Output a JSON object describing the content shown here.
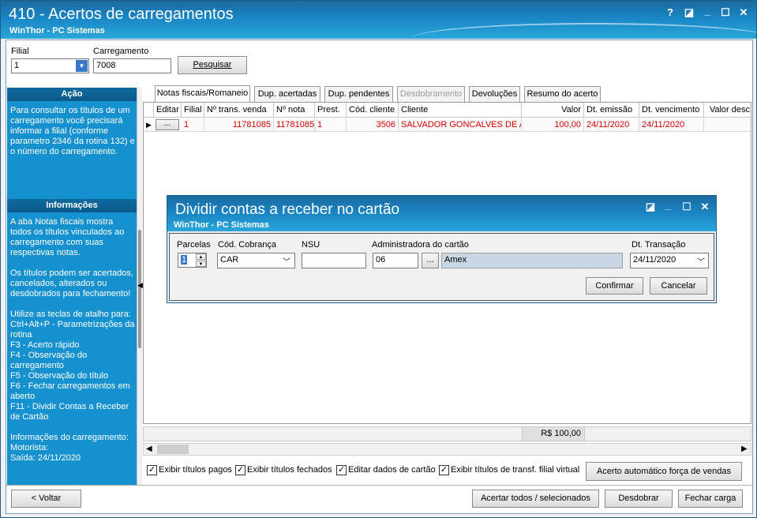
{
  "window": {
    "title": "410 - Acertos de carregamentos",
    "subtitle": "WinThor - PC Sistemas",
    "controls": {
      "help": "?",
      "restore": "◪",
      "minimize": "_",
      "maximize": "☐",
      "close": "✕"
    }
  },
  "filters": {
    "filial_label": "Filial",
    "filial_value": "1",
    "carregamento_label": "Carregamento",
    "carregamento_value": "7008",
    "search_button": "Pesquisar"
  },
  "left_panel": {
    "acao_header": "Ação",
    "acao_text": "Para consultar os títulos de um carregamento você precisará informar a filial (conforme parametro 2346 da rotina 132) e o número do carregamento.",
    "info_header": "Informações",
    "info_text": "A aba Notas fiscais mostra todos os títulos vinculados ao carregamento com suas respectivas notas.\n\nOs títulos podem ser acertados, cancelados, alterados ou desdobrados para fechamento!\n\nUtilize as teclas de atalho para:\nCtrl+Alt+P - Parametrizações da rotina\nF3 - Acerto rápido\nF4 - Observação do carregamento\nF5 - Observação do título\nF6 - Fechar carregamentos em aberto\nF11 - Dividir Contas a Receber de Cartão\n\nInformações do carregamento:\nMotorista:\nSaída: 24/11/2020"
  },
  "tabs": [
    {
      "label": "Notas fiscais/Romaneio",
      "state": "active"
    },
    {
      "label": "Dup. acertadas",
      "state": "normal"
    },
    {
      "label": "Dup. pendentes",
      "state": "normal"
    },
    {
      "label": "Desdobramento",
      "state": "disabled"
    },
    {
      "label": "Devoluções",
      "state": "normal"
    },
    {
      "label": "Resumo do acerto",
      "state": "normal"
    }
  ],
  "grid": {
    "columns": [
      "Editar",
      "Filial",
      "Nº trans. venda",
      "Nº nota",
      "Prest.",
      "Cód. cliente",
      "Cliente",
      "Valor",
      "Dt. emissão",
      "Dt. vencimento",
      "Valor desc"
    ],
    "rows": [
      {
        "edit": "...",
        "filial": "1",
        "trans": "11781085",
        "nota": "11781085",
        "prest": "1",
        "cod_cliente": "3506",
        "cliente": "SALVADOR GONCALVES DE ATAIDE",
        "valor": "100,00",
        "emissao": "24/11/2020",
        "vencimento": "24/11/2020",
        "desc": ""
      }
    ],
    "total": "R$ 100,00"
  },
  "dialog": {
    "title": "Dividir contas a receber no cartão",
    "subtitle": "WinThor - PC Sistemas",
    "parcelas_label": "Parcelas",
    "parcelas_value": "1",
    "cobranca_label": "Cód. Cobrança",
    "cobranca_value": "CAR",
    "nsu_label": "NSU",
    "nsu_value": "",
    "admin_label": "Administradora do cartão",
    "admin_code": "06",
    "admin_name": "Amex",
    "dt_label": "Dt. Transação",
    "dt_value": "24/11/2020",
    "confirm": "Confirmar",
    "cancel": "Cancelar",
    "browse": "..."
  },
  "checkboxes": [
    {
      "label": "Exibir títulos pagos",
      "checked": true
    },
    {
      "label": "Exibir títulos fechados",
      "checked": true
    },
    {
      "label": "Editar dados de cartão",
      "checked": true
    },
    {
      "label": "Exibir títulos de transf. filial virtual",
      "checked": true
    }
  ],
  "buttons": {
    "auto_acerto": "Acerto automático força de vendas",
    "voltar": "< Voltar",
    "acertar": "Acertar todos / selecionados",
    "desdobrar": "Desdobrar",
    "fechar": "Fechar carga"
  }
}
